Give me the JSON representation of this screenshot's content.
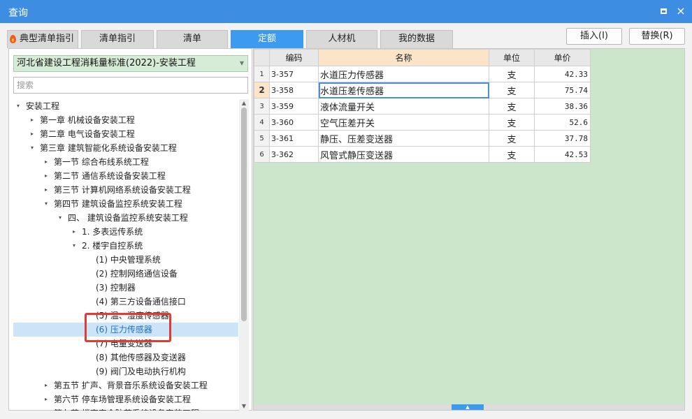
{
  "window": {
    "title": "查询",
    "restore_icon": "restore-icon",
    "close_label": "×"
  },
  "tabs": [
    {
      "label": "典型清单指引",
      "icon": "fire-icon"
    },
    {
      "label": "清单指引"
    },
    {
      "label": "清单"
    },
    {
      "label": "定额",
      "active": true
    },
    {
      "label": "人材机"
    },
    {
      "label": "我的数据"
    }
  ],
  "buttons": {
    "insert": "插入(I)",
    "replace": "替换(R)"
  },
  "library": {
    "selected": "河北省建设工程消耗量标准(2022)-安装工程"
  },
  "search": {
    "placeholder": "搜索"
  },
  "tree": [
    {
      "label": "安装工程",
      "level": 0,
      "toggle": "▾"
    },
    {
      "label": "第一章 机械设备安装工程",
      "level": 1,
      "toggle": "▸"
    },
    {
      "label": "第二章 电气设备安装工程",
      "level": 1,
      "toggle": "▸"
    },
    {
      "label": "第三章 建筑智能化系统设备安装工程",
      "level": 1,
      "toggle": "▾"
    },
    {
      "label": "第一节 综合布线系统工程",
      "level": 2,
      "toggle": "▸"
    },
    {
      "label": "第二节 通信系统设备安装工程",
      "level": 2,
      "toggle": "▸"
    },
    {
      "label": "第三节 计算机网络系统设备安装工程",
      "level": 2,
      "toggle": "▸"
    },
    {
      "label": "第四节 建筑设备监控系统安装工程",
      "level": 2,
      "toggle": "▾"
    },
    {
      "label": "四、 建筑设备监控系统安装工程",
      "level": 3,
      "toggle": "▾"
    },
    {
      "label": "1. 多表远传系统",
      "level": 4,
      "toggle": "▸"
    },
    {
      "label": "2. 楼宇自控系统",
      "level": 4,
      "toggle": "▾"
    },
    {
      "label": "(1) 中央管理系统",
      "level": 5,
      "toggle": ""
    },
    {
      "label": "(2) 控制网络通信设备",
      "level": 5,
      "toggle": ""
    },
    {
      "label": "(3) 控制器",
      "level": 5,
      "toggle": ""
    },
    {
      "label": "(4) 第三方设备通信接口",
      "level": 5,
      "toggle": ""
    },
    {
      "label": "(5) 温、湿度传感器",
      "level": 5,
      "toggle": ""
    },
    {
      "label": "(6) 压力传感器",
      "level": 5,
      "toggle": "",
      "selected": true
    },
    {
      "label": "(7) 电量变送器",
      "level": 5,
      "toggle": ""
    },
    {
      "label": "(8) 其他传感器及变送器",
      "level": 5,
      "toggle": ""
    },
    {
      "label": "(9) 阀门及电动执行机构",
      "level": 5,
      "toggle": ""
    },
    {
      "label": "第五节 扩声、背景音乐系统设备安装工程",
      "level": 2,
      "toggle": "▸"
    },
    {
      "label": "第六节 停车场管理系统设备安装工程",
      "level": 2,
      "toggle": "▸"
    },
    {
      "label": "第七节 楼宇安全防范系统设备安装工程",
      "level": 2,
      "toggle": "▸"
    }
  ],
  "table": {
    "headers": {
      "code": "编码",
      "name": "名称",
      "unit": "单位",
      "price": "单价"
    },
    "rows": [
      {
        "n": "1",
        "code": "3-357",
        "name": "水道压力传感器",
        "unit": "支",
        "price": "42.33"
      },
      {
        "n": "2",
        "code": "3-358",
        "name": "水道压差传感器",
        "unit": "支",
        "price": "75.74",
        "current": true
      },
      {
        "n": "3",
        "code": "3-359",
        "name": "液体流量开关",
        "unit": "支",
        "price": "38.36"
      },
      {
        "n": "4",
        "code": "3-360",
        "name": "空气压差开关",
        "unit": "支",
        "price": "52.6"
      },
      {
        "n": "5",
        "code": "3-361",
        "name": "静压、压差变送器",
        "unit": "支",
        "price": "37.78"
      },
      {
        "n": "6",
        "code": "3-362",
        "name": "风管式静压变送器",
        "unit": "支",
        "price": "42.53"
      }
    ]
  },
  "colors": {
    "titlebar": "#3d8ee3",
    "active_tab": "#3d9bef",
    "grid_background": "#cce6cc",
    "highlight": "#e53935"
  }
}
